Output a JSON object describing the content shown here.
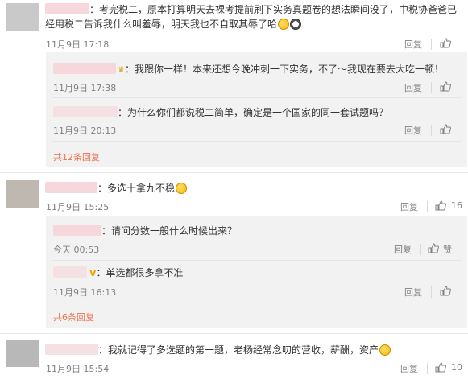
{
  "comments": [
    {
      "text": "：考完税二，原本打算明天去裸考提前刷下实务真题卷的想法瞬间没了，中税协爸爸已",
      "text2": "经用税二告诉我什么叫羞辱，明天我也不自取其辱了哈",
      "time": "11月9日 17:18",
      "reply": "回复",
      "like_icon": "thumb-up-icon",
      "emoji1": "thinking-face",
      "emoji2": "panda-face"
    },
    {
      "text": "：多选十拿九不稳",
      "time": "11月9日 15:25",
      "reply": "回复",
      "likes": "16",
      "emoji": "crying-face"
    },
    {
      "text": "：我就记得了多选题的第一题，老杨经常念叨的营收，薪酬，资产",
      "time": "11月9日 15:54",
      "reply": "回复",
      "likes": "10",
      "emoji": "blushing-face"
    }
  ],
  "replies1": [
    {
      "text": "：我跟你一样！本来还想今晚冲刺一下实务，不了～我现在要去大吃一顿！",
      "time": "11月9日 17:38",
      "reply": "回复"
    },
    {
      "text": "：为什么你们都说税二简单，确定是一个国家的同一套试题吗？",
      "time": "11月9日 20:13",
      "reply": "回复"
    }
  ],
  "more1": "共12条回复",
  "replies2": [
    {
      "text": "：请问分数一般什么时候出来？",
      "time": "今天 00:53",
      "reply": "回复",
      "like": "赞"
    },
    {
      "text": "：单选都很多拿不准",
      "time": "11月9日 16:13",
      "reply": "回复",
      "vip": "V"
    }
  ],
  "more2": "共6条回复"
}
